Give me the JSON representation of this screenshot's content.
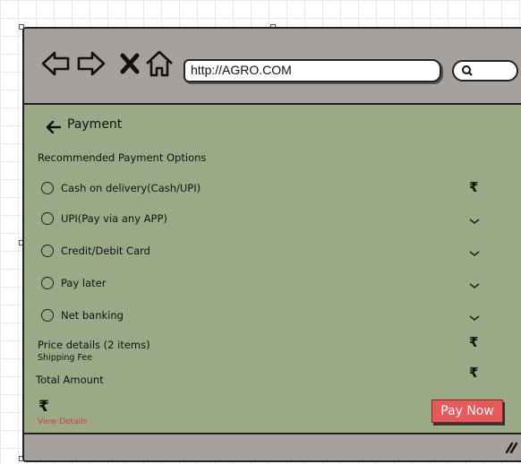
{
  "browser": {
    "url": "http://AGRO.COM",
    "icons": [
      "back-arrow-icon",
      "forward-arrow-icon",
      "close-x-icon",
      "home-icon",
      "search-icon"
    ]
  },
  "page": {
    "back_icon": "left-arrow-icon",
    "title": "Payment",
    "section_label": "Recommended Payment Options",
    "options": [
      {
        "label": "Cash on delivery(Cash/UPI)",
        "right": "₹"
      },
      {
        "label": "UPI(Pay via any APP)",
        "right": "chevron-down-icon"
      },
      {
        "label": "Credit/Debit Card",
        "right": "chevron-down-icon"
      },
      {
        "label": "Pay later",
        "right": "chevron-down-icon"
      },
      {
        "label": "Net banking",
        "right": "chevron-down-icon"
      }
    ],
    "price_details_label": "Price details (2 items)",
    "shipping_fee_label": "Shipping Fee",
    "total_amount_label": "Total Amount",
    "currency_symbol": "₹",
    "view_details_label": "View Details",
    "pay_now_label": "Pay Now"
  },
  "colors": {
    "content_bg": "#9aaa86",
    "chrome_bg": "#a7a19d",
    "pay_button": "#e9595a",
    "view_details": "#d83b3b"
  }
}
